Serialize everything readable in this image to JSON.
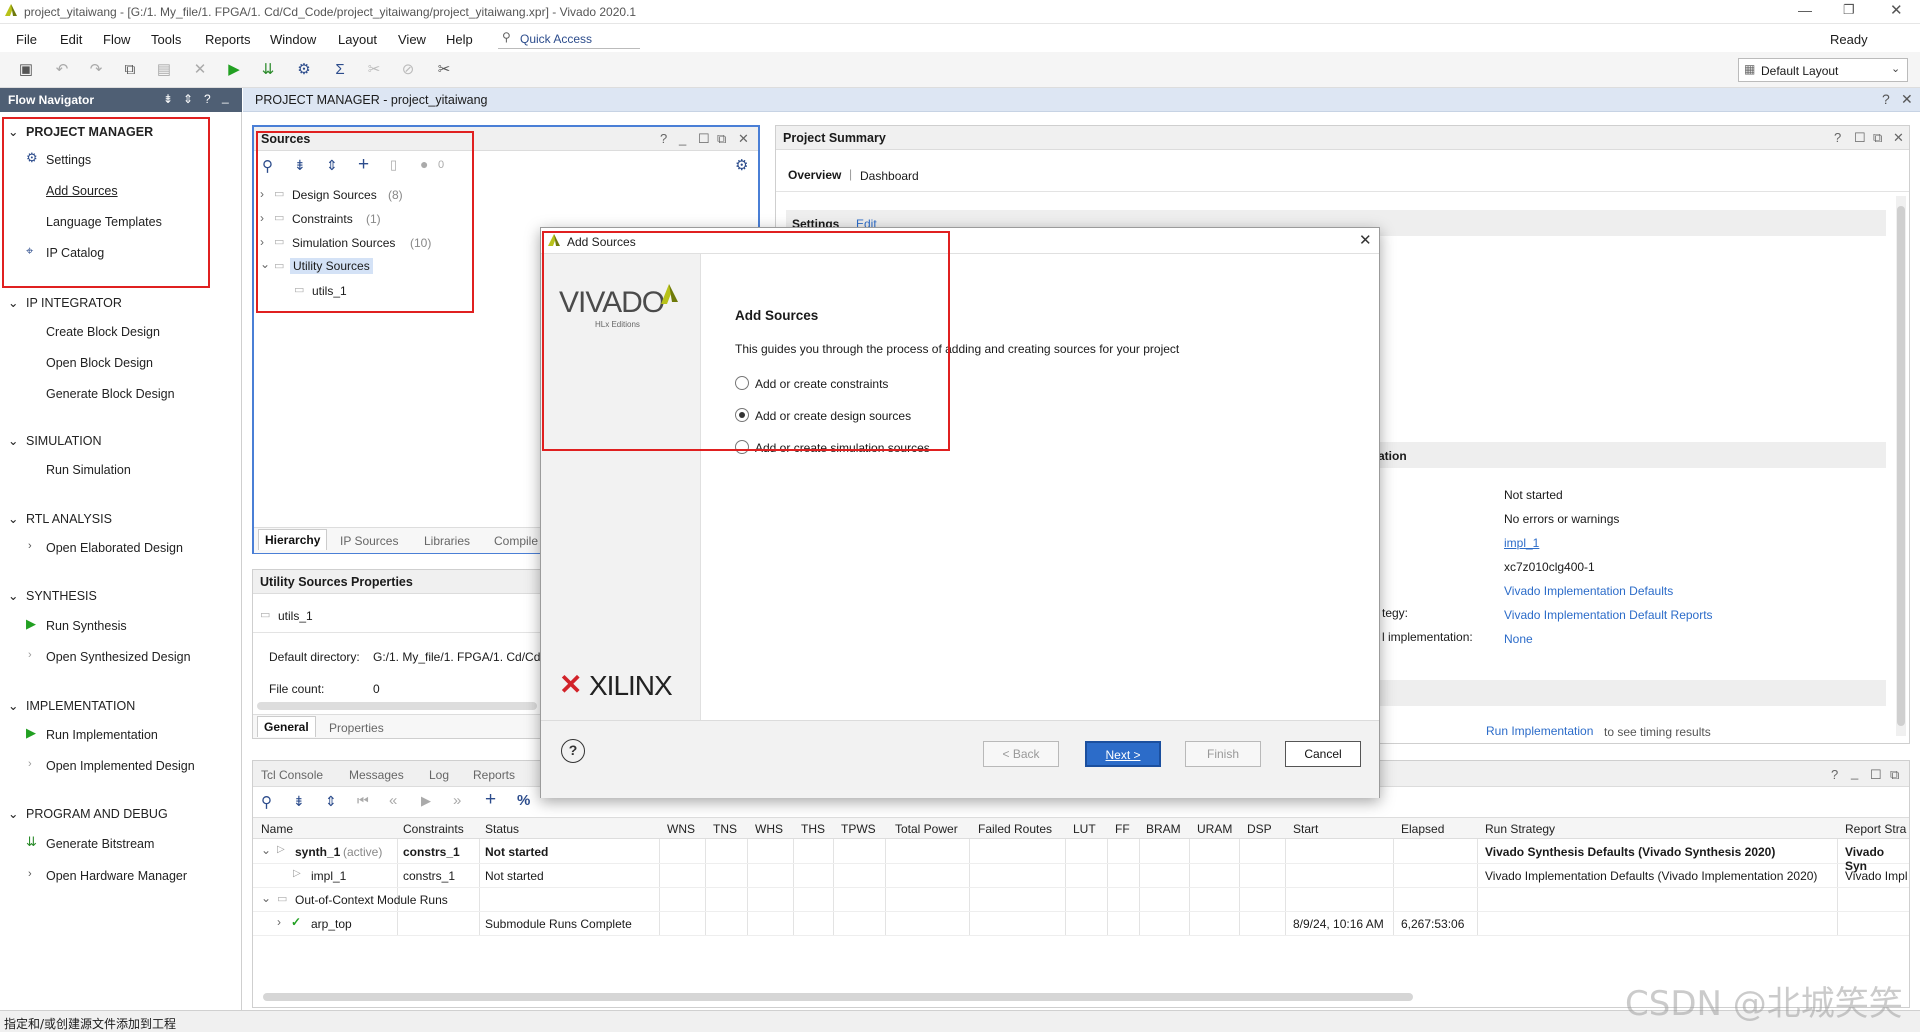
{
  "window": {
    "title": "project_yitaiwang - [G:/1. My_file/1. FPGA/1. Cd/Cd_Code/project_yitaiwang/project_yitaiwang.xpr] - Vivado 2020.1",
    "status": "Ready",
    "quick_access": "Quick Access",
    "layout": "Default Layout"
  },
  "menu": [
    "File",
    "Edit",
    "Flow",
    "Tools",
    "Reports",
    "Window",
    "Layout",
    "View",
    "Help"
  ],
  "flow_navigator": {
    "title": "Flow Navigator",
    "sections": [
      {
        "name": "PROJECT MANAGER",
        "items": [
          "Settings",
          "Add Sources",
          "Language Templates",
          "IP Catalog"
        ]
      },
      {
        "name": "IP INTEGRATOR",
        "items": [
          "Create Block Design",
          "Open Block Design",
          "Generate Block Design"
        ]
      },
      {
        "name": "SIMULATION",
        "items": [
          "Run Simulation"
        ]
      },
      {
        "name": "RTL ANALYSIS",
        "items": [
          "Open Elaborated Design"
        ]
      },
      {
        "name": "SYNTHESIS",
        "items": [
          "Run Synthesis",
          "Open Synthesized Design"
        ]
      },
      {
        "name": "IMPLEMENTATION",
        "items": [
          "Run Implementation",
          "Open Implemented Design"
        ]
      },
      {
        "name": "PROGRAM AND DEBUG",
        "items": [
          "Generate Bitstream",
          "Open Hardware Manager"
        ]
      }
    ]
  },
  "project_manager": {
    "title": "PROJECT MANAGER - project_yitaiwang"
  },
  "sources": {
    "title": "Sources",
    "badge": "0",
    "tree": [
      {
        "label": "Design Sources",
        "count": "(8)"
      },
      {
        "label": "Constraints",
        "count": "(1)"
      },
      {
        "label": "Simulation Sources",
        "count": "(10)"
      },
      {
        "label": "Utility Sources",
        "count": ""
      },
      {
        "label": "utils_1",
        "count": ""
      }
    ],
    "tabs": [
      "Hierarchy",
      "IP Sources",
      "Libraries",
      "Compile"
    ]
  },
  "properties": {
    "title": "Utility Sources Properties",
    "item": "utils_1",
    "default_dir_label": "Default directory:",
    "default_dir_value": "G:/1. My_file/1. FPGA/1. Cd/Cd",
    "file_count_label": "File count:",
    "file_count_value": "0",
    "tabs": [
      "General",
      "Properties"
    ]
  },
  "summary": {
    "title": "Project Summary",
    "tabs": [
      "Overview",
      "Dashboard"
    ],
    "settings": "Settings",
    "edit": "Edit",
    "section_partial": "ation",
    "labels": [
      "tegy:",
      "l implementation:"
    ],
    "values": [
      "Not started",
      "No errors or warnings",
      "impl_1",
      "xc7z010clg400-1",
      "Vivado Implementation Defaults",
      "Vivado Implementation Default Reports",
      "None"
    ],
    "run_impl_link": "Run Implementation",
    "run_impl_text": "to see timing results"
  },
  "dialog": {
    "title": "Add Sources",
    "heading": "Add Sources",
    "description": "This guides you through the process of adding and creating sources for your project",
    "options": [
      {
        "label": "Add or create constraints",
        "selected": false
      },
      {
        "label": "Add or create design sources",
        "selected": true
      },
      {
        "label": "Add or create simulation sources",
        "selected": false
      }
    ],
    "vivado_logo": "VIVADO",
    "vivado_sub": "HLx Editions",
    "xilinx_logo": "XILINX",
    "buttons": {
      "back": "< Back",
      "next": "Next >",
      "finish": "Finish",
      "cancel": "Cancel"
    }
  },
  "console": {
    "tabs": [
      "Tcl Console",
      "Messages",
      "Log",
      "Reports"
    ],
    "headers": [
      "Name",
      "Constraints",
      "Status",
      "WNS",
      "TNS",
      "WHS",
      "THS",
      "TPWS",
      "Total Power",
      "Failed Routes",
      "LUT",
      "FF",
      "BRAM",
      "URAM",
      "DSP",
      "Start",
      "Elapsed",
      "Run Strategy",
      "Report Stra"
    ],
    "rows": [
      {
        "name": "synth_1",
        "tag": "(active)",
        "constraints": "constrs_1",
        "status": "Not started",
        "start": "",
        "elapsed": "",
        "strategy": "Vivado Synthesis Defaults (Vivado Synthesis 2020)",
        "report": "Vivado Syn"
      },
      {
        "name": "impl_1",
        "tag": "",
        "constraints": "constrs_1",
        "status": "Not started",
        "start": "",
        "elapsed": "",
        "strategy": "Vivado Implementation Defaults (Vivado Implementation 2020)",
        "report": "Vivado Impl"
      },
      {
        "name": "Out-of-Context Module Runs",
        "tag": "",
        "constraints": "",
        "status": "",
        "start": "",
        "elapsed": "",
        "strategy": "",
        "report": ""
      },
      {
        "name": "arp_top",
        "tag": "",
        "constraints": "",
        "status": "Submodule Runs Complete",
        "start": "8/9/24, 10:16 AM",
        "elapsed": "6,267:53:06",
        "strategy": "",
        "report": ""
      }
    ]
  },
  "statusbar": {
    "text": "指定和/或创建源文件添加到工程"
  },
  "watermark": "CSDN @北城笑笑",
  "colors": {
    "accent": "#2c6cc9",
    "nav_header": "#4f5f74",
    "highlight": "#e02020",
    "run_green": "#22a022"
  }
}
